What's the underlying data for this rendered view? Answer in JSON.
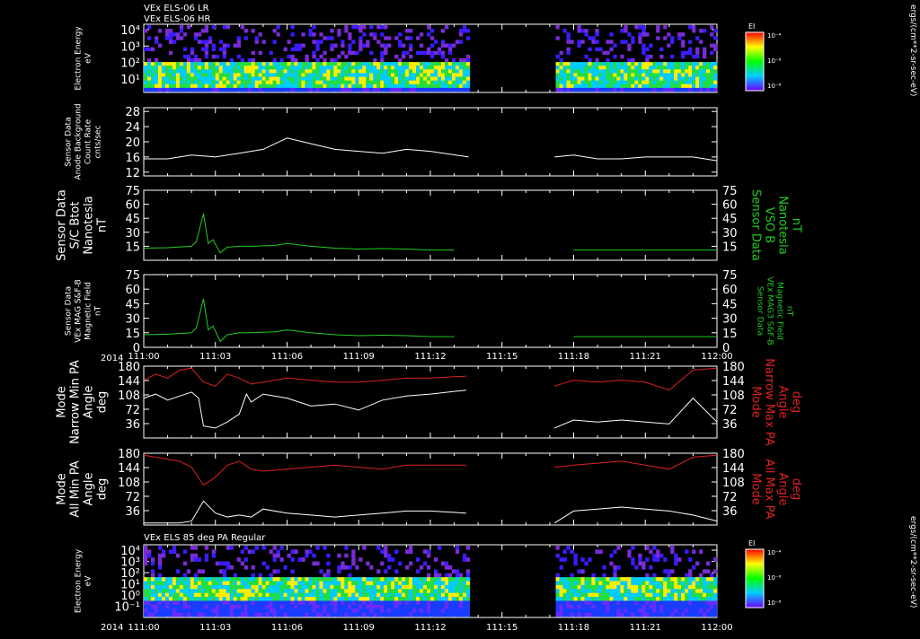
{
  "header": {
    "line1": "VEx ELS-06 LR",
    "line2": "VEx ELS-06 HR"
  },
  "year": "2014",
  "time_ticks": [
    "111:00",
    "111:03",
    "111:06",
    "111:09",
    "111:12",
    "111:15",
    "111:18",
    "111:21",
    "112:00"
  ],
  "colorbar": {
    "title": "EI",
    "ticks": [
      "10⁻⁴",
      "10⁻⁶",
      "10⁻⁸"
    ],
    "unit": "ergs/(cm**2-sr-sec-eV)"
  },
  "colors": {
    "white": "#ffffff",
    "green": "#22cc22",
    "red": "#dd2222"
  },
  "panels": [
    {
      "id": "spec1",
      "type": "heatmap",
      "left_label": [
        "Electron Energy",
        "eV"
      ],
      "yticks": [
        "10⁴",
        "10³",
        "10²",
        "10¹"
      ]
    },
    {
      "id": "bkg",
      "type": "line",
      "left_label": [
        "Sensor Data",
        "Anode Background",
        "Count Rate",
        "cnts/sec"
      ],
      "yticks": [
        "28",
        "24",
        "20",
        "16",
        "12"
      ],
      "ylim": [
        11,
        29
      ]
    },
    {
      "id": "btot",
      "type": "line",
      "left_label": [
        "Sensor Data",
        "S/C Btot",
        "Nanotesla",
        "nT"
      ],
      "right_label": [
        "Sensor Data",
        "VSO B",
        "Nanotesla",
        "nT"
      ],
      "yticks": [
        "75",
        "60",
        "45",
        "30",
        "15"
      ],
      "ylim": [
        0,
        75
      ]
    },
    {
      "id": "mag",
      "type": "line",
      "left_label": [
        "Sensor Data",
        "VEx MAG S&F-B",
        "Magnetic Field",
        "nT"
      ],
      "right_label": [
        "Sensor Data",
        "VEx MAG3 S&F-B",
        "Magnetic Field",
        "nT"
      ],
      "yticks": [
        "75",
        "60",
        "45",
        "30",
        "15",
        "0"
      ],
      "ylim": [
        0,
        75
      ]
    },
    {
      "id": "narrow",
      "type": "line",
      "left_label": [
        "Mode",
        "Narrow Min PA",
        "Angle",
        "deg"
      ],
      "right_label": [
        "Mode",
        "Narrow Max PA",
        "Angle",
        "deg"
      ],
      "yticks": [
        "180",
        "144",
        "108",
        "72",
        "36"
      ],
      "ylim": [
        0,
        180
      ]
    },
    {
      "id": "all",
      "type": "line",
      "left_label": [
        "Mode",
        "All Min PA",
        "Angle",
        "deg"
      ],
      "right_label": [
        "Mode",
        "All Max PA",
        "Angle",
        "deg"
      ],
      "yticks": [
        "180",
        "144",
        "108",
        "72",
        "36"
      ],
      "ylim": [
        0,
        180
      ]
    },
    {
      "id": "spec2",
      "type": "heatmap",
      "title": "VEx ELS 85 deg PA Regular",
      "left_label": [
        "Electron Energy",
        "eV"
      ],
      "yticks": [
        "10⁴",
        "10³",
        "10²",
        "10¹",
        "10⁰",
        "10⁻¹"
      ]
    }
  ],
  "chart_data": {
    "type": "line",
    "x_unit": "day:hour",
    "gap_hours": [
      [
        13.6,
        17.2
      ]
    ],
    "series": [
      {
        "panel": "bkg",
        "x": [
          0,
          1,
          2,
          3,
          4,
          5,
          6,
          7,
          8,
          9,
          10,
          11,
          12,
          13.6,
          17.2,
          18,
          19,
          20,
          21,
          22,
          23,
          24
        ],
        "values": [
          15.5,
          15.5,
          16.5,
          16,
          17,
          18,
          21,
          19.5,
          18,
          17.5,
          17,
          18,
          17.5,
          16,
          16,
          16.5,
          15.5,
          15.5,
          16,
          16,
          16,
          15
        ]
      },
      {
        "panel": "btot",
        "x": [
          0,
          1,
          2,
          2.2,
          2.5,
          2.7,
          2.9,
          3.2,
          3.5,
          4,
          4.5,
          5,
          5.5,
          6,
          7,
          8,
          9,
          10,
          11,
          12,
          13,
          14,
          15,
          16,
          17,
          18,
          19,
          20,
          21,
          22,
          23,
          24
        ],
        "values": [
          13,
          13.5,
          15,
          20,
          50,
          18,
          22,
          8,
          14,
          15,
          15,
          15.5,
          16,
          18,
          15,
          13,
          12,
          12.5,
          12,
          11,
          11,
          11,
          11,
          11,
          11,
          11,
          11,
          11,
          11,
          11,
          11,
          11
        ]
      },
      {
        "panel": "mag",
        "x": [
          0,
          1,
          2,
          2.2,
          2.5,
          2.7,
          2.9,
          3.2,
          3.5,
          4,
          4.5,
          5,
          5.5,
          6,
          7,
          8,
          9,
          10,
          11,
          12,
          13,
          14,
          15,
          16,
          17,
          18,
          19,
          20,
          21,
          22,
          23,
          24
        ],
        "values": [
          13,
          13.5,
          15,
          20,
          50,
          18,
          22,
          6,
          13,
          15,
          15,
          15.5,
          16,
          18,
          15,
          13,
          12,
          12.5,
          12,
          11,
          11,
          11,
          11,
          11,
          11,
          11,
          11,
          11,
          11,
          11,
          11,
          11
        ]
      },
      {
        "panel": "narrow",
        "name": "Min",
        "color": "white",
        "x": [
          0,
          0.5,
          1,
          1.5,
          2,
          2.3,
          2.5,
          3,
          3.5,
          4,
          4.3,
          4.5,
          5,
          6,
          7,
          8,
          9,
          10,
          11,
          12,
          13.5,
          17.2,
          18,
          19,
          20,
          21,
          22,
          23,
          24
        ],
        "values": [
          100,
          110,
          95,
          105,
          115,
          100,
          30,
          25,
          40,
          60,
          110,
          90,
          110,
          100,
          80,
          85,
          70,
          95,
          105,
          110,
          120,
          25,
          45,
          40,
          45,
          40,
          35,
          100,
          40
        ]
      },
      {
        "panel": "narrow",
        "name": "Max",
        "color": "red",
        "x": [
          0,
          0.5,
          1,
          1.5,
          2,
          2.5,
          3,
          3.5,
          4,
          4.5,
          5,
          6,
          7,
          8,
          9,
          10,
          11,
          12,
          13.5,
          17.2,
          18,
          19,
          20,
          21,
          22,
          23,
          24
        ],
        "values": [
          145,
          160,
          150,
          170,
          175,
          140,
          130,
          160,
          150,
          135,
          140,
          150,
          145,
          140,
          140,
          145,
          150,
          150,
          155,
          130,
          145,
          140,
          145,
          140,
          120,
          170,
          175
        ]
      },
      {
        "panel": "all",
        "name": "Min",
        "color": "white",
        "x": [
          0,
          0.5,
          1,
          1.5,
          2,
          2.5,
          3,
          3.5,
          4,
          4.5,
          5,
          6,
          7,
          8,
          9,
          10,
          11,
          12,
          13.5,
          17.2,
          18,
          19,
          20,
          21,
          22,
          23,
          24
        ],
        "values": [
          5,
          5,
          5,
          5,
          10,
          60,
          30,
          20,
          25,
          20,
          40,
          30,
          25,
          20,
          25,
          30,
          35,
          35,
          30,
          5,
          35,
          40,
          45,
          40,
          35,
          25,
          10
        ]
      },
      {
        "panel": "all",
        "name": "Max",
        "color": "red",
        "x": [
          0,
          0.5,
          1,
          1.5,
          2,
          2.5,
          3,
          3.5,
          4,
          4.5,
          5,
          6,
          7,
          8,
          9,
          10,
          11,
          12,
          13.5,
          17.2,
          18,
          19,
          20,
          21,
          22,
          23,
          24
        ],
        "values": [
          175,
          170,
          165,
          160,
          145,
          100,
          120,
          150,
          160,
          140,
          135,
          140,
          145,
          150,
          145,
          140,
          150,
          150,
          150,
          145,
          150,
          155,
          160,
          150,
          140,
          170,
          175
        ]
      }
    ]
  }
}
